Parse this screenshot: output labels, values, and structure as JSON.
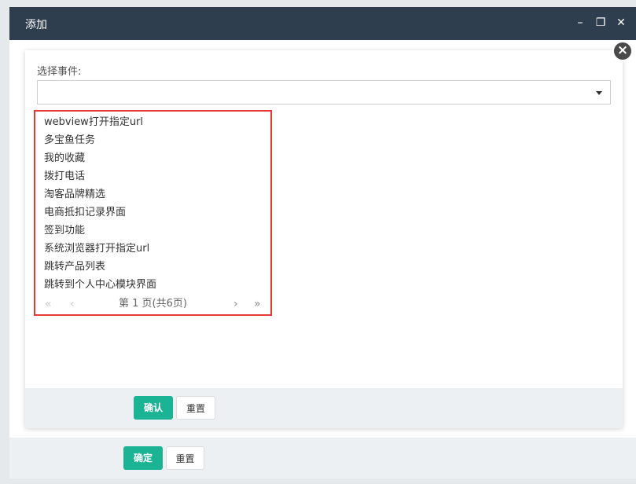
{
  "outer_dialog": {
    "title": "添加",
    "minimize_glyph": "–",
    "restore_glyph": "❐",
    "close_glyph": "✕",
    "confirm_label": "确定",
    "reset_label": "重置"
  },
  "inner_dialog": {
    "close_glyph": "×",
    "event_label": "选择事件:",
    "select_value": "",
    "confirm_label": "确认",
    "reset_label": "重置"
  },
  "event_options": [
    "webview打开指定url",
    "多宝鱼任务",
    "我的收藏",
    "拨打电话",
    "淘客品牌精选",
    "电商抵扣记录界面",
    "签到功能",
    "系统浏览器打开指定url",
    "跳转产品列表",
    "跳转到个人中心模块界面"
  ],
  "pagination": {
    "text": "第 1 页(共6页)",
    "first_glyph": "«",
    "prev_glyph": "‹",
    "next_glyph": "›",
    "last_glyph": "»"
  },
  "colors": {
    "titlebar": "#2f3e4f",
    "primary": "#1ab394",
    "highlight_border": "#e53935"
  }
}
